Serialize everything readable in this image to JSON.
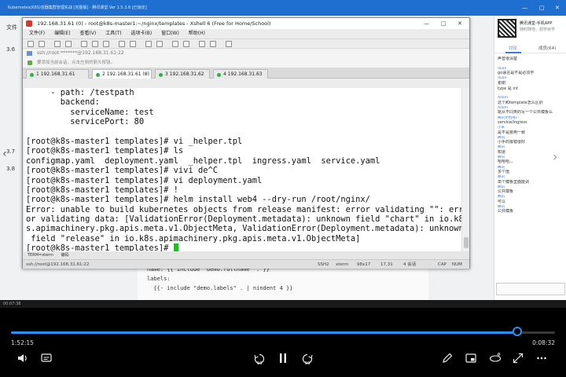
{
  "outer_window": {
    "title": "Kubernetes(K8S)容器集群管理实战 [完整版] - 腾讯课堂 Ver 1.5.3.6 [已锁定]",
    "controls": [
      "—",
      "□",
      "✕"
    ]
  },
  "document": {
    "left_items": [
      "文件",
      "3.6",
      "3.7",
      "3.8"
    ],
    "code_lines": [
      "name: {{ include \"demo.fullname\" . }}",
      "labels:",
      "  {{- include \"demo.labels\" . | nindent 4 }}"
    ]
  },
  "xshell": {
    "title": "192.168.31.61 (0) - root@k8s-master1:~/nginx/templates - Xshell 6 (Free for Home/School)",
    "menu": [
      "文件(F)",
      "编辑(E)",
      "查看(V)",
      "工具(T)",
      "选项卡(B)",
      "窗口(W)",
      "帮助(H)"
    ],
    "address": "ssh://root:*******@192.168.31.61:22",
    "hint": "要添加当前会话，点击左侧的箭头按钮。",
    "tabs": [
      {
        "label": "1 192.168.31.61",
        "active": false
      },
      {
        "label": "2 192.168.31.61 (0)",
        "active": true
      },
      {
        "label": "3 192.168.31.62",
        "active": false
      },
      {
        "label": "4 192.168.31.63",
        "active": false
      }
    ],
    "terminal_lines": [
      "     - path: /testpath",
      "       backend:",
      "         serviceName: test",
      "         servicePort: 80",
      "",
      "[root@k8s-master1 templates]# vi _helper.tpl",
      "[root@k8s-master1 templates]# ls",
      "configmap.yaml  deployment.yaml  _helper.tpl  ingress.yaml  service.yaml",
      "[root@k8s-master1 templates]# vivi de^C",
      "[root@k8s-master1 templates]# vi deployment.yaml",
      "[root@k8s-master1 templates]# !",
      "[root@k8s-master1 templates]# helm install web4 --dry-run /root/nginx/",
      "Error: unable to build kubernetes objects from release manifest: error validating \"\": err",
      "or validating data: [ValidationError(Deployment.metadata): unknown field \"chart\" in io.k8",
      "s.apimachinery.pkg.apis.meta.v1.ObjectMeta, ValidationError(Deployment.metadata): unknown",
      " field \"release\" in io.k8s.apimachinery.pkg.apis.meta.v1.ObjectMeta]"
    ],
    "prompt_line": "[root@k8s-master1 templates]# ",
    "bottom_tabs": [
      "TERM=xterm",
      "编码"
    ],
    "status": {
      "session": "ssh://root@192.168.31.61:22",
      "protocol": "SSH2",
      "term": "xterm",
      "size": "98x17",
      "cursor": "17,31",
      "sessions": "4 会话",
      "cap": "CAP",
      "num": "NUM"
    }
  },
  "chat": {
    "promo": "腾讯课堂-手机APP",
    "promo_sub": "随时随地，想学就学",
    "tabs": [
      "讨论",
      "成员(64)"
    ],
    "messages": [
      {
        "name": "",
        "text": "声音很清楚"
      },
      {
        "name": "duan",
        "text": "go语言是不是必须学"
      },
      {
        "name": "duan",
        "text": "谢谢"
      },
      {
        "name": "",
        "text": "type 是 int"
      },
      {
        "name": "Adam",
        "text": "这个和template怎么区别"
      },
      {
        "name": "Adam",
        "text": "能从不同类的写一个公共模板么"
      },
      {
        "name": "腾讯文档用户",
        "text": "service/ingress"
      },
      {
        "name": "小米",
        "text": "是不是要用一致"
      },
      {
        "name": "腾讯",
        "text": "小手的报错很好"
      },
      {
        "name": "腾讯",
        "text": "知道"
      },
      {
        "name": "腾讯",
        "text": "哈哈哈。。"
      },
      {
        "name": "腾讯",
        "text": "多个值"
      },
      {
        "name": "腾讯",
        "text": "单个模板里面能调"
      },
      {
        "name": "腾讯",
        "text": "公共模板"
      },
      {
        "name": "腾讯",
        "text": "可以"
      },
      {
        "name": "腾讯",
        "text": "公共模板"
      }
    ]
  },
  "player": {
    "strip_text": "00:07:38",
    "current_time": "1:52:15",
    "remaining_time": "0:08:32",
    "progress": 0.93,
    "rewind_label": "10",
    "forward_label": "30",
    "accent": "#2a8ff7"
  }
}
